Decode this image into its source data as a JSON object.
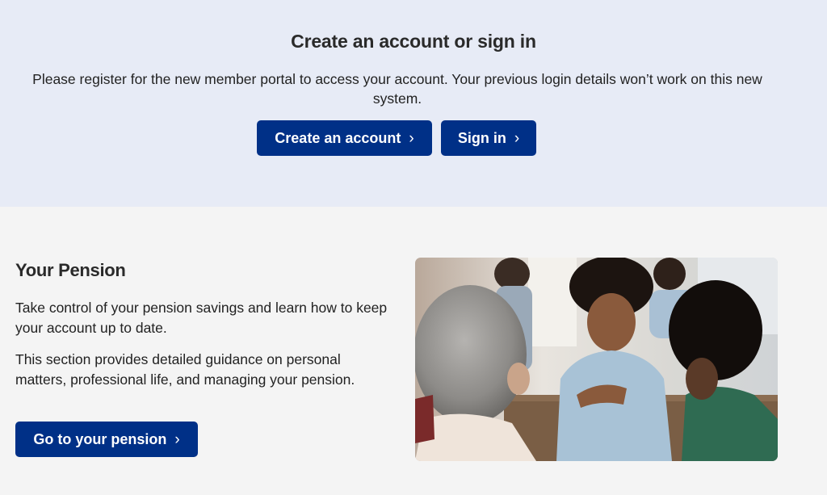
{
  "hero": {
    "title": "Create an account or sign in",
    "description": "Please register for the new member portal to access your account. Your previous login details won’t work on this new system.",
    "create_label": "Create an account",
    "signin_label": "Sign in"
  },
  "pension": {
    "title": "Your Pension",
    "paragraph1": "Take control of your pension savings and learn how to keep your account up to date.",
    "paragraph2": "This section provides detailed guidance on personal matters, professional life, and managing your pension.",
    "button_label": "Go to your pension"
  },
  "colors": {
    "hero_bg": "#e7ebf6",
    "section_bg": "#f4f4f4",
    "button_bg": "#003087",
    "button_text": "#ffffff"
  },
  "icons": {
    "button_chevron": "chevron-right-icon"
  }
}
